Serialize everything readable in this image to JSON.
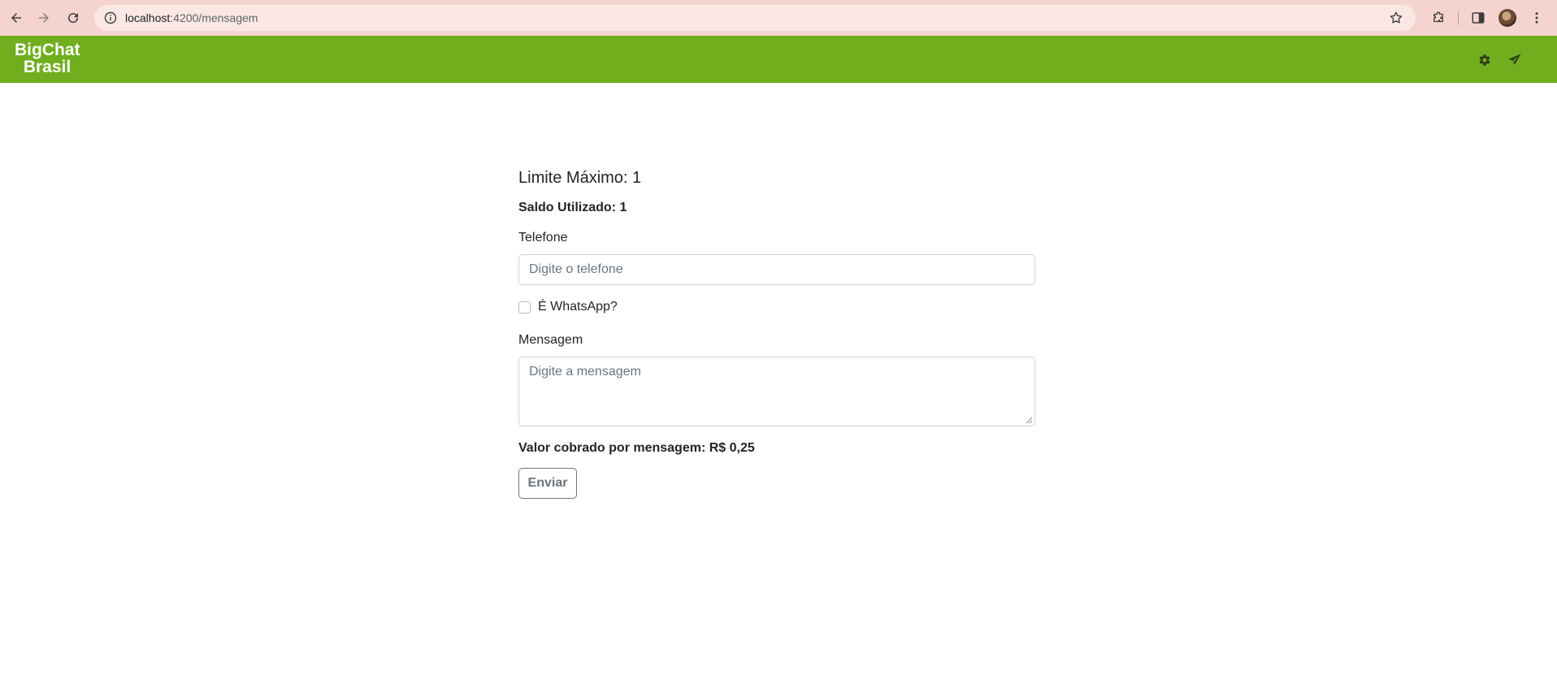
{
  "browser": {
    "url_host": "localhost",
    "url_path": ":4200/mensagem"
  },
  "app": {
    "brand_line1": "BigChat",
    "brand_line2": "Brasil",
    "header_color": "#70ae1e",
    "icons": [
      "gear-icon",
      "send-icon"
    ]
  },
  "form": {
    "limit_title": "Limite Máximo: 1",
    "saldo": "Saldo Utilizado: 1",
    "phone_label": "Telefone",
    "phone_placeholder": "Digite o telefone",
    "phone_value": "",
    "whatsapp_label": "É WhatsApp?",
    "whatsapp_checked": false,
    "message_label": "Mensagem",
    "message_placeholder": "Digite a mensagem",
    "message_value": "",
    "valor": "Valor cobrado por mensagem: R$ 0,25",
    "submit_label": "Enviar"
  }
}
